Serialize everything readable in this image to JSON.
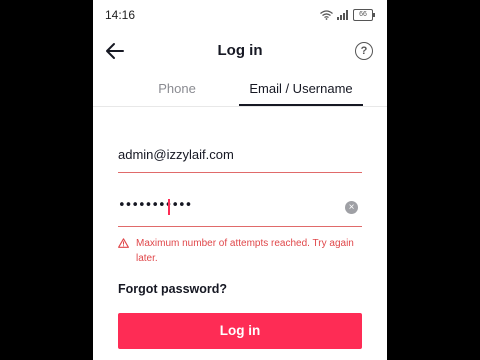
{
  "status_bar": {
    "time": "14:16",
    "battery": "66"
  },
  "header": {
    "title": "Log in",
    "help_glyph": "?"
  },
  "tabs": [
    {
      "label": "Phone",
      "active": false
    },
    {
      "label": "Email / Username",
      "active": true
    }
  ],
  "form": {
    "email_value": "admin@izzylaif.com",
    "password_masked": "•••••••••••",
    "clear_glyph": "×"
  },
  "error": {
    "message": "Maximum number of attempts reached. Try again later."
  },
  "forgot_password_label": "Forgot password?",
  "login_button_label": "Log in",
  "colors": {
    "accent": "#fe2c55",
    "error": "#e0474a",
    "text": "#161823",
    "muted": "#8a8b91"
  },
  "icons": [
    "wifi-icon",
    "signal-icon",
    "battery-icon",
    "back-arrow-icon",
    "help-icon",
    "clear-icon",
    "warning-icon"
  ]
}
